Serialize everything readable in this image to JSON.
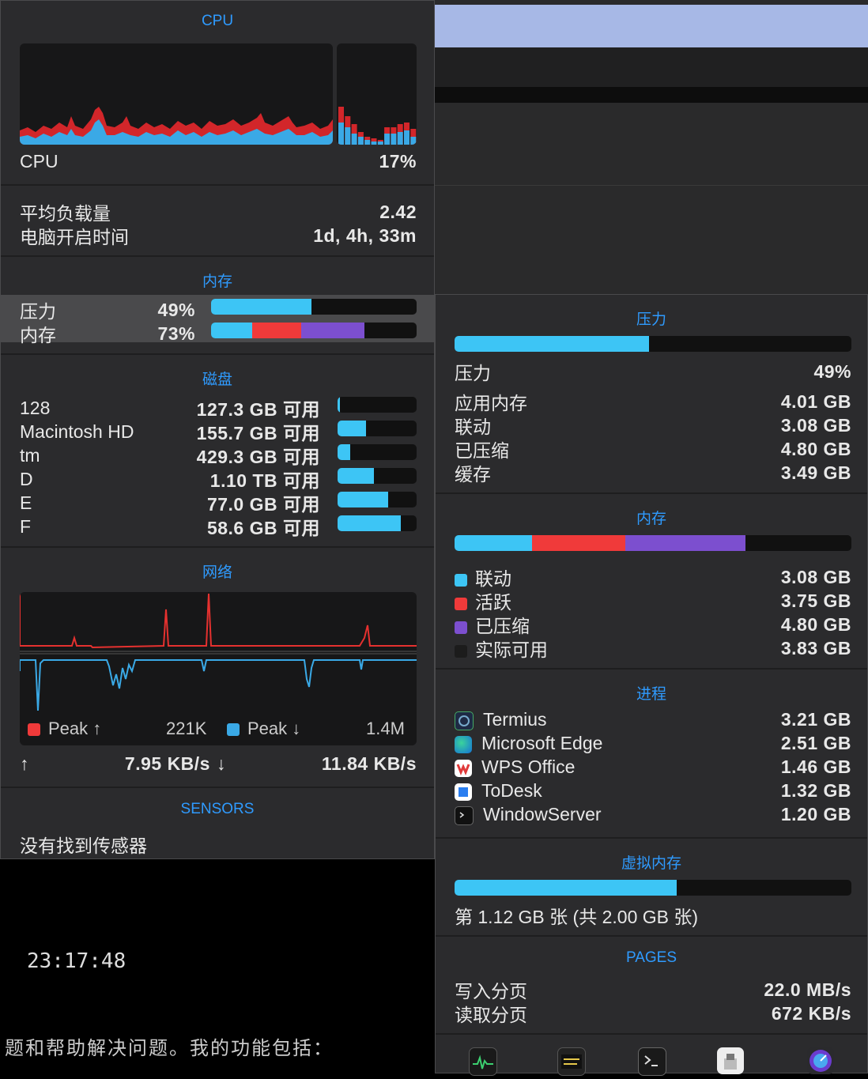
{
  "left": {
    "cpu": {
      "title": "CPU",
      "label": "CPU",
      "value": "17%",
      "load_label": "平均负载量",
      "load_value": "2.42",
      "uptime_label": "电脑开启时间",
      "uptime_value": "1d, 4h, 33m"
    },
    "memory": {
      "title": "内存",
      "pressure_label": "压力",
      "pressure_value": "49%",
      "pressure_fraction": 0.49,
      "memory_label": "内存",
      "memory_value": "73%"
    },
    "disk": {
      "title": "磁盘",
      "items": [
        {
          "name": "128",
          "free": "127.3 GB 可用",
          "used_fraction": 0.02
        },
        {
          "name": "Macintosh HD",
          "free": "155.7 GB 可用",
          "used_fraction": 0.36
        },
        {
          "name": "tm",
          "free": "429.3 GB 可用",
          "used_fraction": 0.16
        },
        {
          "name": "D",
          "free": "1.10 TB 可用",
          "used_fraction": 0.46
        },
        {
          "name": "E",
          "free": "77.0 GB 可用",
          "used_fraction": 0.64
        },
        {
          "name": "F",
          "free": "58.6 GB 可用",
          "used_fraction": 0.8
        }
      ]
    },
    "network": {
      "title": "网络",
      "peak_up_label": "Peak ↑",
      "peak_up_value": "221K",
      "peak_down_label": "Peak ↓",
      "peak_down_value": "1.4M",
      "up_arrow": "↑",
      "up_rate": "7.95 KB/s",
      "down_arrow": "↓",
      "down_rate": "11.84 KB/s"
    },
    "sensors": {
      "title": "SENSORS",
      "message": "没有找到传感器"
    }
  },
  "right": {
    "pressure": {
      "title": "压力",
      "fraction": 0.49,
      "label": "压力",
      "value": "49%",
      "rows": [
        {
          "label": "应用内存",
          "value": "4.01 GB"
        },
        {
          "label": "联动",
          "value": "3.08 GB"
        },
        {
          "label": "已压缩",
          "value": "4.80 GB"
        },
        {
          "label": "缓存",
          "value": "3.49 GB"
        }
      ]
    },
    "memory": {
      "title": "内存",
      "legend": [
        {
          "label": "联动",
          "value": "3.08 GB",
          "color": "#3dc5f5"
        },
        {
          "label": "活跃",
          "value": "3.75 GB",
          "color": "#f03a3a"
        },
        {
          "label": "已压缩",
          "value": "4.80 GB",
          "color": "#7c4fcf"
        },
        {
          "label": "实际可用",
          "value": "3.83 GB",
          "color": "#1c1c1c"
        }
      ]
    },
    "processes": {
      "title": "进程",
      "items": [
        {
          "name": "Termius",
          "value": "3.21 GB",
          "icon": "termius-icon"
        },
        {
          "name": "Microsoft Edge",
          "value": "2.51 GB",
          "icon": "edge-icon"
        },
        {
          "name": "WPS Office",
          "value": "1.46 GB",
          "icon": "wps-icon"
        },
        {
          "name": "ToDesk",
          "value": "1.32 GB",
          "icon": "todesk-icon"
        },
        {
          "name": "WindowServer",
          "value": "1.20 GB",
          "icon": "windowserver-icon"
        }
      ]
    },
    "virtual_memory": {
      "title": "虚拟内存",
      "fraction": 0.56,
      "text": "第 1.12 GB 张 (共 2.00 GB 张)"
    },
    "pages": {
      "title": "PAGES",
      "write_label": "写入分页",
      "write_value": "22.0 MB/s",
      "read_label": "读取分页",
      "read_value": "672 KB/s"
    }
  },
  "terminal": {
    "time": "23:17:48",
    "text": "题和帮助解决问题。我的功能包括："
  },
  "colors": {
    "accent": "#2f9bff",
    "cyan": "#3dc5f5",
    "red": "#f03a3a",
    "purple": "#7c4fcf"
  }
}
